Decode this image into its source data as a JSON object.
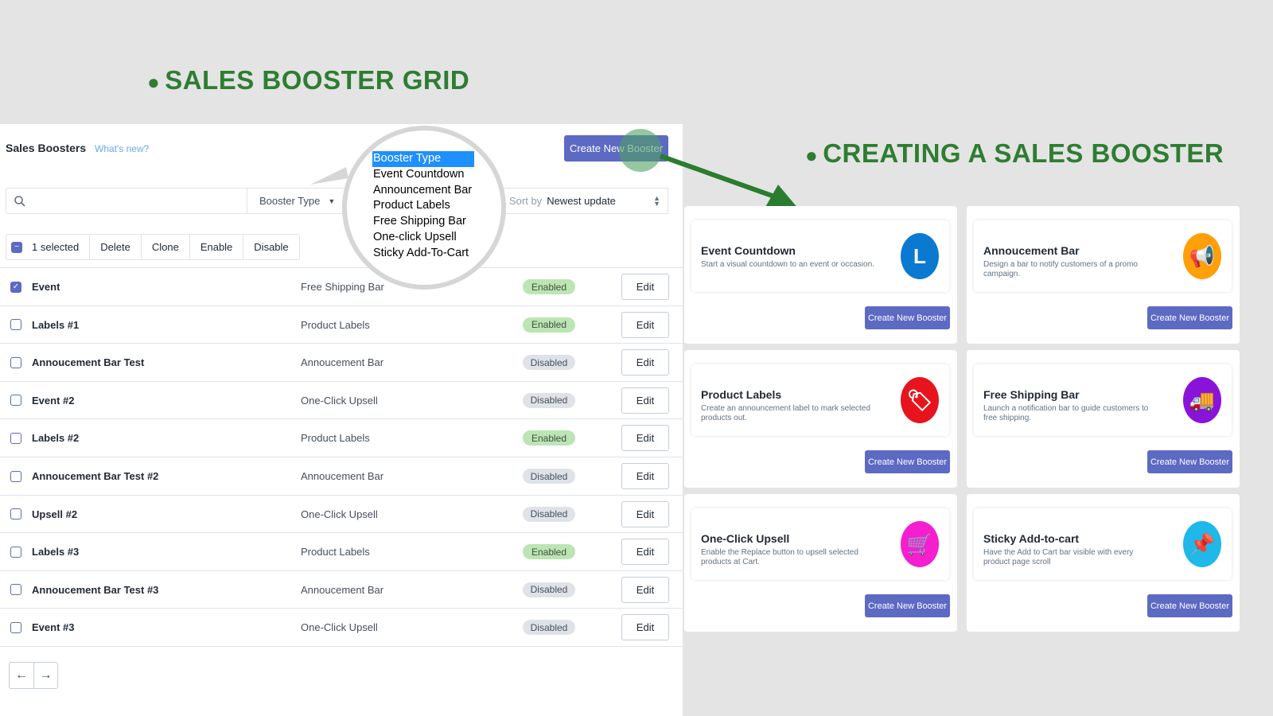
{
  "headings": {
    "grid": "SALES BOOSTER GRID",
    "create": "CREATING A SALES BOOSTER"
  },
  "grid": {
    "title": "Sales Boosters",
    "whats_new": "What's new?",
    "create_button": "Create New Booster",
    "search": {
      "placeholder": "",
      "value": ""
    },
    "type_filter": "Booster Type",
    "sort_label": "Sort by",
    "sort_value": "Newest update",
    "bulk": {
      "selected": "1 selected",
      "delete": "Delete",
      "clone": "Clone",
      "enable": "Enable",
      "disable": "Disable"
    },
    "dropdown_options": [
      "Booster Type",
      "Event Countdown",
      "Announcement Bar",
      "Product Labels",
      "Free Shipping Bar",
      "One-click Upsell",
      "Sticky Add-To-Cart"
    ],
    "edit_label": "Edit",
    "rows": [
      {
        "name": "Event",
        "type": "Free Shipping Bar",
        "status": "Enabled",
        "checked": true
      },
      {
        "name": "Labels #1",
        "type": "Product Labels",
        "status": "Enabled",
        "checked": false
      },
      {
        "name": "Annoucement Bar Test",
        "type": "Annoucement Bar",
        "status": "Disabled",
        "checked": false
      },
      {
        "name": "Event #2",
        "type": "One-Click Upsell",
        "status": "Disabled",
        "checked": false
      },
      {
        "name": "Labels #2",
        "type": "Product Labels",
        "status": "Enabled",
        "checked": false
      },
      {
        "name": "Annoucement Bar Test #2",
        "type": "Annoucement Bar",
        "status": "Disabled",
        "checked": false
      },
      {
        "name": "Upsell #2",
        "type": "One-Click Upsell",
        "status": "Disabled",
        "checked": false
      },
      {
        "name": "Labels #3",
        "type": "Product Labels",
        "status": "Enabled",
        "checked": false
      },
      {
        "name": "Annoucement Bar Test #3",
        "type": "Annoucement Bar",
        "status": "Disabled",
        "checked": false
      },
      {
        "name": "Event #3",
        "type": "One-Click Upsell",
        "status": "Disabled",
        "checked": false
      }
    ],
    "pagination": {
      "prev": "←",
      "next": "→"
    }
  },
  "cards": [
    {
      "title": "Event Countdown",
      "desc": "Start a visual countdown to an event or occasion.",
      "icon": "clock-icon",
      "glyph": "L",
      "color": "#0a7ad1",
      "button": "Create New Booster"
    },
    {
      "title": "Annoucement Bar",
      "desc": "Design a bar to notify customers of a promo campaign.",
      "icon": "megaphone-icon",
      "glyph": "📢",
      "color": "#ff9f0a",
      "button": "Create New Booster"
    },
    {
      "title": "Product Labels",
      "desc": "Create an announcement label to mark selected products out.",
      "icon": "tag-icon",
      "glyph": "🏷",
      "color": "#e8141d",
      "button": "Create New Booster"
    },
    {
      "title": "Free Shipping Bar",
      "desc": "Launch a notification bar to guide customers to free shipping.",
      "icon": "truck-icon",
      "glyph": "🚚",
      "color": "#8a13d9",
      "button": "Create New Booster"
    },
    {
      "title": "One-Click Upsell",
      "desc": "Enable the Replace button to upsell selected products at Cart.",
      "icon": "cart-plus-icon",
      "glyph": "🛒",
      "color": "#f51fcf",
      "button": "Create New Booster"
    },
    {
      "title": "Sticky Add-to-cart",
      "desc": "Have the Add to Cart bar visible with every product page scroll",
      "icon": "pin-icon",
      "glyph": "📌",
      "color": "#1fb8e8",
      "button": "Create New Booster"
    }
  ],
  "colors": {
    "heading": "#2e7d32",
    "primary": "#5c6ac4",
    "enabled": "#bbe5b3",
    "disabled": "#dfe3e8"
  }
}
